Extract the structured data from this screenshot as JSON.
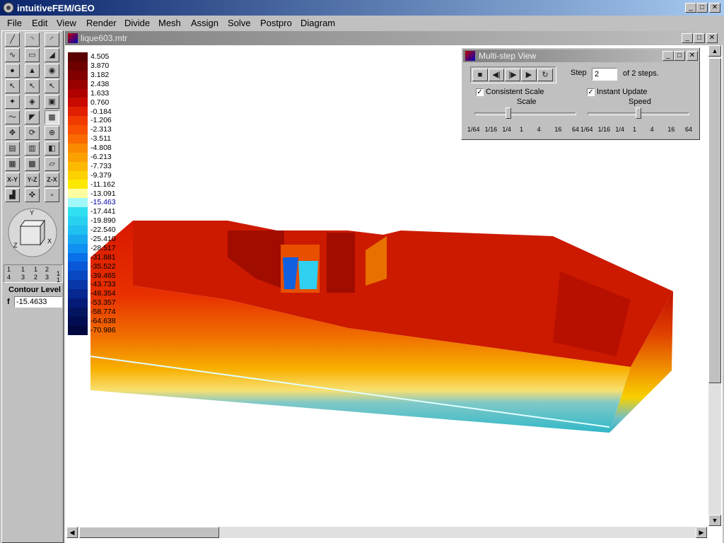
{
  "app": {
    "title": "intuitiveFEM/GEO"
  },
  "menu": [
    "File",
    "Edit",
    "View",
    "Render",
    "Divide",
    "Mesh",
    "Assign",
    "Solve",
    "Postpro",
    "Diagram"
  ],
  "document": {
    "title": "lique603.mtr"
  },
  "toolbox": {
    "contour_label": "Contour Level",
    "f_label": "f",
    "contour_value": "-15.4633",
    "plane_buttons": [
      "X-Y",
      "Y-Z",
      "Z-X"
    ],
    "level_indicator": [
      "1",
      "1",
      "1",
      "2",
      "1",
      "4",
      "3",
      "2",
      "3",
      "1"
    ]
  },
  "legend": {
    "values": [
      "4.505",
      "3.870",
      "3.182",
      "2.438",
      "1.633",
      "0.760",
      "-0.184",
      "-1.206",
      "-2.313",
      "-3.511",
      "-4.808",
      "-6.213",
      "-7.733",
      "-9.379",
      "-11.162",
      "-13.091",
      "-15.463",
      "-17.441",
      "-19.890",
      "-22.540",
      "-25.410",
      "-28.517",
      "-31.881",
      "-35.522",
      "-39.465",
      "-43.733",
      "-48.354",
      "-53.357",
      "-58.774",
      "-64.638",
      "-70.986"
    ],
    "colors": [
      "#5a0000",
      "#6e0000",
      "#820000",
      "#980000",
      "#b00000",
      "#c80a00",
      "#e02000",
      "#f03a00",
      "#f85000",
      "#fa6a00",
      "#fb8a00",
      "#fca000",
      "#fdb800",
      "#fdd000",
      "#fde800",
      "#fefea0",
      "#a0f8f8",
      "#30e0f0",
      "#28d0f0",
      "#20c0f0",
      "#18a8f0",
      "#1090f0",
      "#0870e8",
      "#0858d8",
      "#0848c0",
      "#0838a8",
      "#062890",
      "#041c78",
      "#031460",
      "#020c50",
      "#010840"
    ],
    "highlight_index": 16
  },
  "multistep": {
    "title": "Multi-step View",
    "step_label": "Step",
    "step_value": "2",
    "of_steps": "of 2 steps.",
    "consistent_scale": "Consistent Scale",
    "instant_update": "Instant Update",
    "scale_label": "Scale",
    "speed_label": "Speed",
    "ticks": [
      "1/64",
      "1/16",
      "1/4",
      "1",
      "4",
      "16",
      "64"
    ],
    "scale_position": 0.33,
    "speed_position": 0.5
  },
  "colors": {
    "titlebar": "#0a246a",
    "face": "#c0c0c0"
  }
}
